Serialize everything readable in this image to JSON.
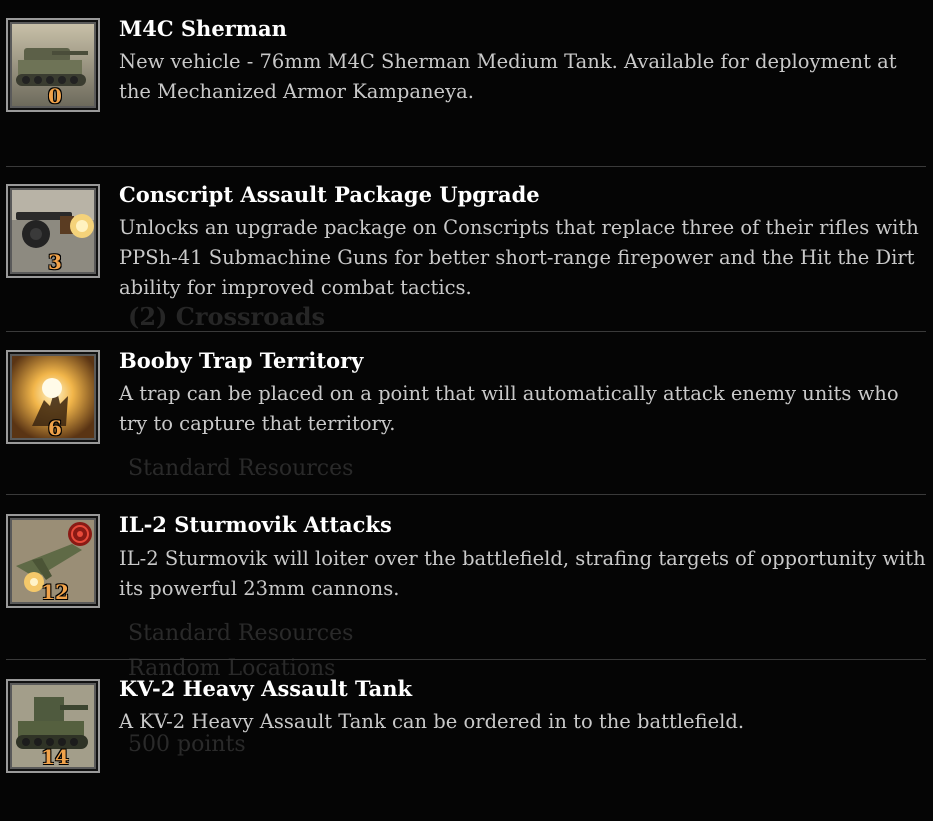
{
  "colors": {
    "background": "#050505",
    "title": "#ffffff",
    "description": "#c9c9c9",
    "cost": "#f0a24a",
    "divider": "#3a3a3a"
  },
  "background_ghost_text": {
    "crossroads": "(2) Crossroads",
    "standard_resources_1": "Standard Resources",
    "standard_resources_2": "Standard Resources",
    "random_locations": "Random Locations",
    "points": "500 points"
  },
  "upgrades": [
    {
      "title": "M4C Sherman",
      "description": "New vehicle - 76mm M4C Sherman Medium Tank. Available for deployment at the Mechanized Armor Kampaneya.",
      "cost": "0",
      "icon": "sherman-tank-icon"
    },
    {
      "title": "Conscript Assault Package Upgrade",
      "description": "Unlocks an upgrade package on Conscripts that replace three of their rifles with PPSh-41 Submachine Guns for better short-range firepower and the Hit the Dirt ability for improved combat tactics.",
      "cost": "3",
      "icon": "submachine-gun-icon"
    },
    {
      "title": "Booby Trap Territory",
      "description": "A trap can be placed on a point that will automatically attack enemy units who try to capture that territory.",
      "cost": "6",
      "icon": "explosion-icon"
    },
    {
      "title": "IL-2 Sturmovik Attacks",
      "description": "IL-2 Sturmovik will loiter over the battlefield, strafing targets of opportunity with its powerful 23mm cannons.",
      "cost": "12",
      "icon": "aircraft-target-icon"
    },
    {
      "title": "KV-2 Heavy Assault Tank",
      "description": "A KV-2 Heavy Assault Tank can be ordered in to the battlefield.",
      "cost": "14",
      "icon": "kv2-tank-icon"
    }
  ]
}
